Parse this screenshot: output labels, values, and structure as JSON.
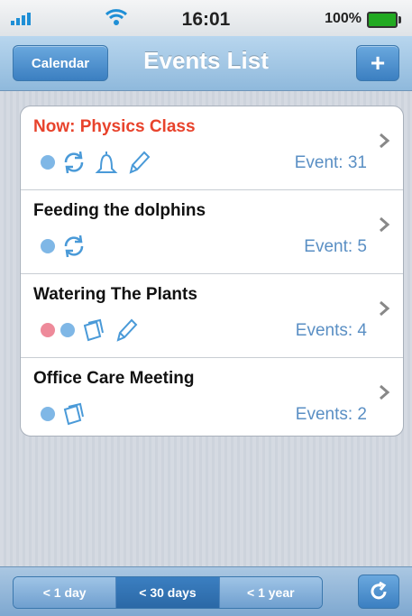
{
  "status": {
    "carrier": "ııll.",
    "time": "16:01",
    "battery": "100%"
  },
  "nav": {
    "left_label": "Calendar",
    "title": "Events List",
    "right_label": "+"
  },
  "events": [
    {
      "title": "Now: Physics Class",
      "count": "Event: 31",
      "icons": [
        "dot-blue",
        "repeat-icon",
        "bell-icon",
        "pencil-icon"
      ]
    },
    {
      "title": "Feeding the dolphins",
      "count": "Event: 5",
      "icons": [
        "dot-blue",
        "repeat-icon"
      ]
    },
    {
      "title": "Watering The Plants",
      "count": "Events: 4",
      "icons": [
        "dot-pink",
        "dot-blue",
        "notes-icon",
        "pencil-icon"
      ]
    },
    {
      "title": "Office Care Meeting",
      "count": "Events: 2",
      "icons": [
        "dot-blue",
        "notes-icon"
      ]
    }
  ],
  "tabs": {
    "segments": [
      "< 1 day",
      "< 30 days",
      "< 1 year"
    ],
    "active": "< 30 days"
  },
  "colors": {
    "accent": "#3b7fc1",
    "now_title": "#e8432c",
    "count_text": "#5a8fc4",
    "dot_blue": "#7fb7e6",
    "dot_pink": "#ee8a9a"
  }
}
